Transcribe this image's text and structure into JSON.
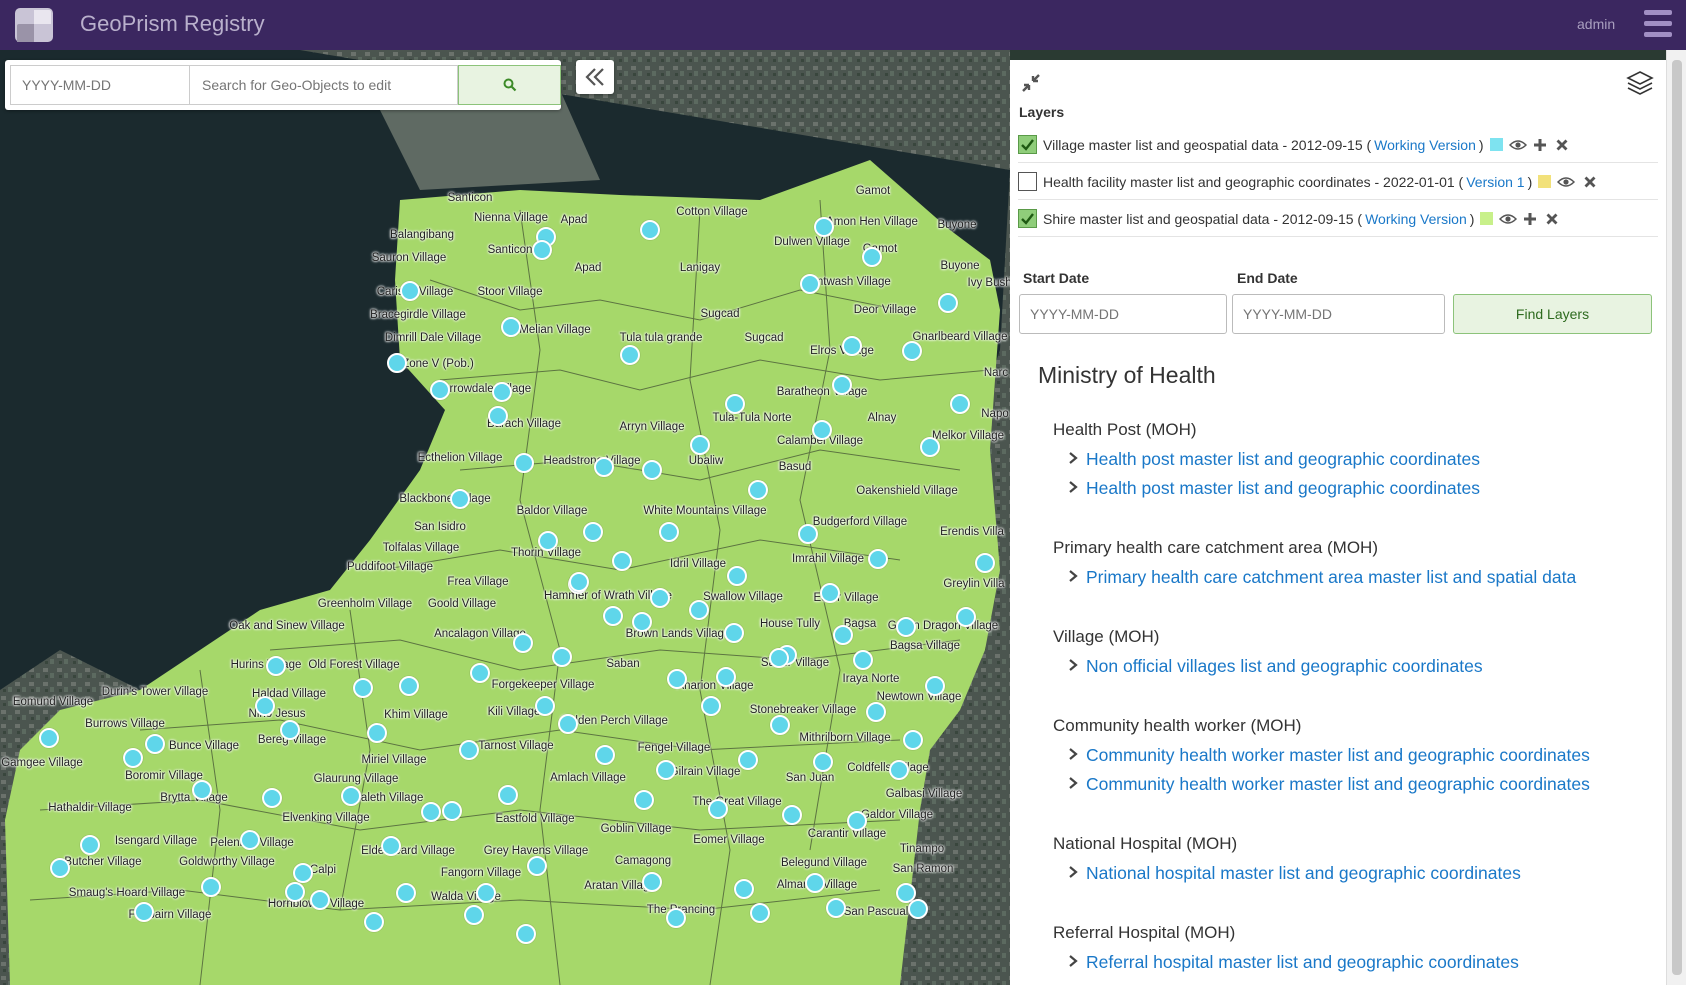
{
  "header": {
    "app_title": "GeoPrism Registry",
    "user": "admin"
  },
  "search": {
    "date_placeholder": "YYYY-MM-DD",
    "query_placeholder": "Search for Geo-Objects to edit"
  },
  "panel": {
    "layers_title": "Layers",
    "layers": [
      {
        "checked": true,
        "name": "Village master list and geospatial data - 2012-09-15 (",
        "version": "Working Version",
        "close_paren": ")",
        "color": "#7ee3f0",
        "has_add": true
      },
      {
        "checked": false,
        "name": "Health facility master list and geographic coordinates - 2022-01-01 (",
        "version": "Version 1",
        "close_paren": ")",
        "color": "#f2e17a",
        "has_add": false
      },
      {
        "checked": true,
        "name": "Shire master list and geospatial data - 2012-09-15 (",
        "version": "Working Version",
        "close_paren": ")",
        "color": "#c8f08a",
        "has_add": true
      }
    ],
    "start_date_label": "Start Date",
    "end_date_label": "End Date",
    "start_date_placeholder": "YYYY-MM-DD",
    "end_date_placeholder": "YYYY-MM-DD",
    "find_button": "Find Layers",
    "organization": "Ministry of Health",
    "types": [
      {
        "title": "Health Post (MOH)",
        "links": [
          "Health post master list and geographic coordinates",
          "Health post master list and geographic coordinates"
        ]
      },
      {
        "title": "Primary health care catchment area (MOH)",
        "links": [
          "Primary health care catchment area master list and spatial data"
        ]
      },
      {
        "title": "Village (MOH)",
        "links": [
          "Non official villages list and geographic coordinates"
        ]
      },
      {
        "title": "Community health worker (MOH)",
        "links": [
          "Community health worker master list and geographic coordinates",
          "Community health worker master list and geographic coordinates"
        ]
      },
      {
        "title": "National Hospital (MOH)",
        "links": [
          "National hospital master list and geographic coordinates"
        ]
      },
      {
        "title": "Referral Hospital (MOH)",
        "links": [
          "Referral hospital master list and geographic coordinates"
        ]
      }
    ]
  },
  "map": {
    "land_color": "#a6d86a",
    "marker_color": "#5fd6ea",
    "labels": [
      "Santicon",
      "Nienna Village",
      "Apad",
      "Cotton Village",
      "Gamot",
      "Amon Hen Village",
      "Buyone",
      "Balangibang",
      "Sauron Village",
      "Santicon",
      "Apad",
      "Lanigay",
      "Dulwen Village",
      "Gamot",
      "Buyone",
      "Ivy Bush V",
      "Carisac Village",
      "Stoor Village",
      "Entwash Village",
      "Deor Village",
      "Bracegirdle Village",
      "Sugcad",
      "Melian Village",
      "Gnarlbeard Village",
      "Dimrill Dale Village",
      "Tula tula grande",
      "Sugcad",
      "Elros Village",
      "Zone V (Pob.)",
      "Harrowdale Village",
      "Narc",
      "Baratheon Village",
      "Napo",
      "Tula-Tula Norte",
      "Alnay",
      "Barach Village",
      "Arryn Village",
      "Calambel Village",
      "Melkor Village",
      "Ecthelion Village",
      "Headstrong Village",
      "Ubaliw",
      "Basud",
      "Oakenshield Village",
      "Blackbone Village",
      "Baldor Village",
      "White Mountains Village",
      "Budgerford Village",
      "San Isidro",
      "Erendis Villa",
      "Tolfalas Village",
      "Thorin Village",
      "Idril Village",
      "Imrahil Village",
      "Puddifoot Village",
      "Frea Village",
      "Hammer of Wrath Village",
      "Greylin Villa",
      "Greenholm Village",
      "Goold Village",
      "Swallow Village",
      "Eofor Village",
      "Oak and Sinew Village",
      "House Tully",
      "Bagsa",
      "Green Dragon Village",
      "Ancalagon Village",
      "Brown Lands Village",
      "Bagsa Village",
      "Hurins Village",
      "Old Forest Village",
      "Saban",
      "Sador Village",
      "Iraya Norte",
      "Eomund Village",
      "Durin's Tower Village",
      "Haldad Village",
      "Forgekeeper Village",
      "Anarion Village",
      "Newtown Village",
      "Burrows Village",
      "Nino Jesus",
      "Khim Village",
      "Kili Village",
      "Stonebreaker Village",
      "Bunce Village",
      "Bereg Village",
      "Golden Perch Village",
      "Gamgee Village",
      "Miriel Village",
      "Tarnost Village",
      "Fengel Village",
      "Mithrilborn Village",
      "Boromir Village",
      "Glaurung Village",
      "Amlach Village",
      "Gilrain Village",
      "San Juan",
      "Coldfells Village",
      "Brytta Village",
      "Haleth Village",
      "Galbasi Village",
      "Hathaldir Village",
      "Elvenking Village",
      "Eastfold Village",
      "The Great Village",
      "Galdor Village",
      "Isengard Village",
      "Pelennor Village",
      "Goblin Village",
      "Carantir Village",
      "Elderbeard Village",
      "Eomer Village",
      "Tinampo",
      "Butcher Village",
      "Goldworthy Village",
      "Grey Havens Village",
      "Camagong",
      "Belegund Village",
      "San Ramon",
      "Calpi",
      "Fangorn Village",
      "Almaren Village",
      "Smaug's Hoard Village",
      "Hornblower Village",
      "Walda Village",
      "Aratan Village",
      "San Pascual",
      "Fairbairn Village",
      "The Prancing"
    ]
  }
}
